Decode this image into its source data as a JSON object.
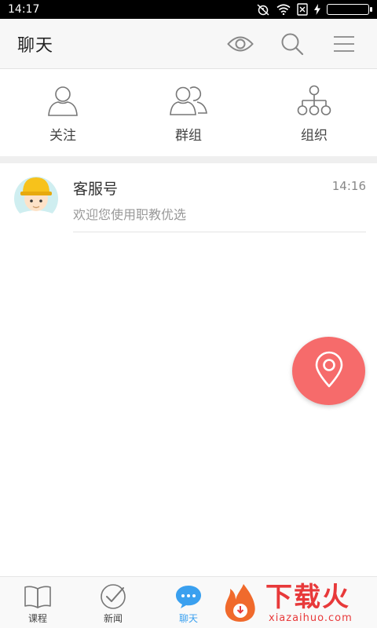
{
  "status_bar": {
    "time": "14:17",
    "icons": [
      "alarm-off-icon",
      "wifi-icon",
      "sim-off-icon",
      "charging-icon",
      "battery-icon"
    ],
    "battery_color": "#4cd964"
  },
  "header": {
    "title": "聊天",
    "icons": [
      "eye-icon",
      "search-icon",
      "menu-icon"
    ]
  },
  "quick_actions": [
    {
      "label": "关注",
      "icon": "user-icon"
    },
    {
      "label": "群组",
      "icon": "group-icon"
    },
    {
      "label": "组织",
      "icon": "org-chart-icon"
    }
  ],
  "chats": [
    {
      "name": "客服号",
      "time": "14:16",
      "preview": "欢迎您使用职教优选",
      "avatar": "helmet-boy-avatar"
    }
  ],
  "fab": {
    "icon": "location-pin-icon",
    "color": "#f66b6b"
  },
  "tabs": [
    {
      "label": "课程",
      "icon": "book-icon",
      "active": false
    },
    {
      "label": "新闻",
      "icon": "check-circle-icon",
      "active": false
    },
    {
      "label": "聊天",
      "icon": "chat-bubble-icon",
      "active": true
    }
  ],
  "watermark": {
    "cn": "下载火",
    "en": "xiazaihuo.com",
    "color": "#e8393a"
  },
  "colors": {
    "accent": "#3aa0ef",
    "fab": "#f66b6b"
  }
}
